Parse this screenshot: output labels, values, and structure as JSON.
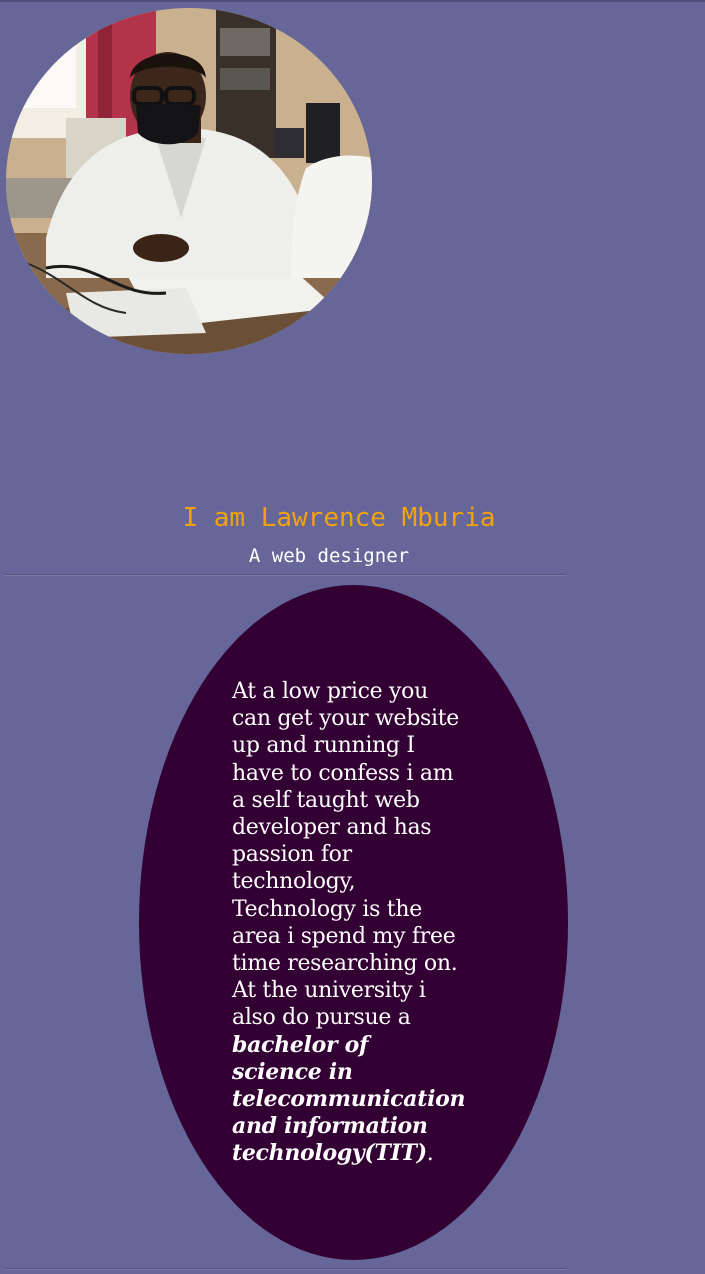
{
  "profile": {
    "photo_alt": "Lawrence Mburia photo",
    "name_heading": "I am Lawrence Mburia",
    "tagline": "A web designer"
  },
  "bio": {
    "text_plain": "At a low price you can get your website up and running I have to confess i am a self taught web developer and has passion for technology, Technology is the area i spend my free time researching on. At the university i also do pursue a ",
    "text_emphasis": "bachelor of science in telecommunication and information technology(TIT)",
    "text_end": "."
  },
  "colors": {
    "page_background": "#666699",
    "heading": "#f2a20f",
    "oval_background": "#330033",
    "text": "#ffffff"
  }
}
